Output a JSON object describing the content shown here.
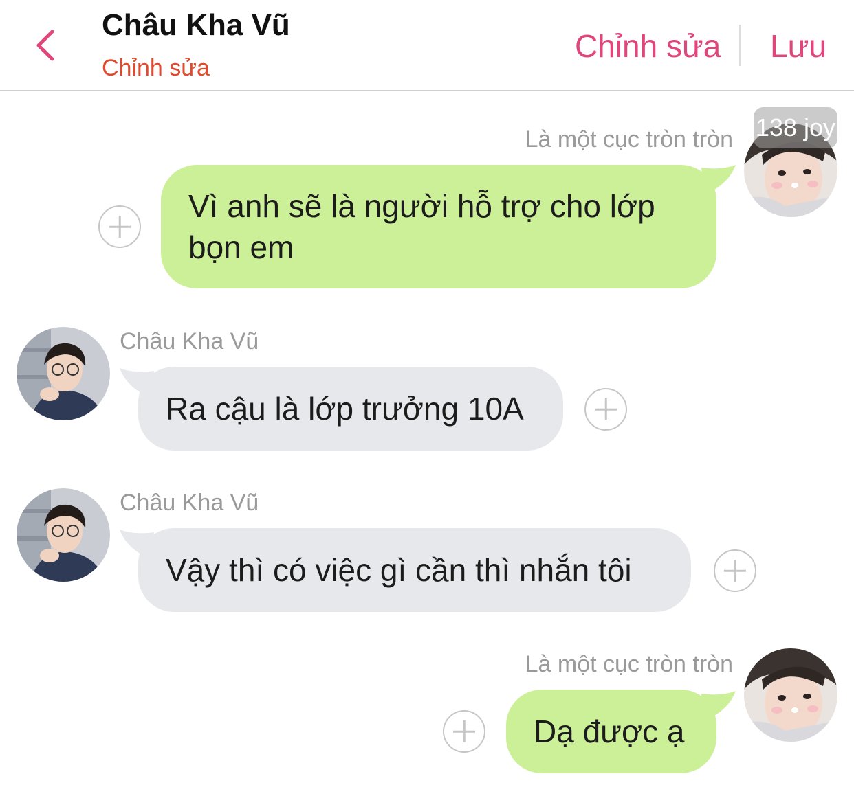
{
  "header": {
    "title": "Châu Kha Vũ",
    "subtitle": "Chỉnh sửa",
    "edit_label": "Chỉnh sửa",
    "save_label": "Lưu"
  },
  "badge": {
    "text": "138 joy"
  },
  "messages": [
    {
      "sender": "Là một cục tròn tròn",
      "side": "right",
      "text_lines": [
        "Vì anh sẽ là người hỗ trợ cho lớp",
        "bọn em"
      ]
    },
    {
      "sender": "Châu Kha Vũ",
      "side": "left",
      "text": "Ra cậu là lớp trưởng 10A"
    },
    {
      "sender": "Châu Kha Vũ",
      "side": "left",
      "text": "Vậy thì có việc gì cần thì nhắn tôi"
    },
    {
      "sender": "Là một cục tròn tròn",
      "side": "right",
      "text": "Dạ được ạ"
    }
  ],
  "colors": {
    "accent": "#e0457b",
    "subtitle": "#e04a2e",
    "bubble_sent": "#ccf097",
    "bubble_received": "#e6e8ec"
  },
  "icons": [
    "chevron-left-icon",
    "add-reaction-icon"
  ]
}
